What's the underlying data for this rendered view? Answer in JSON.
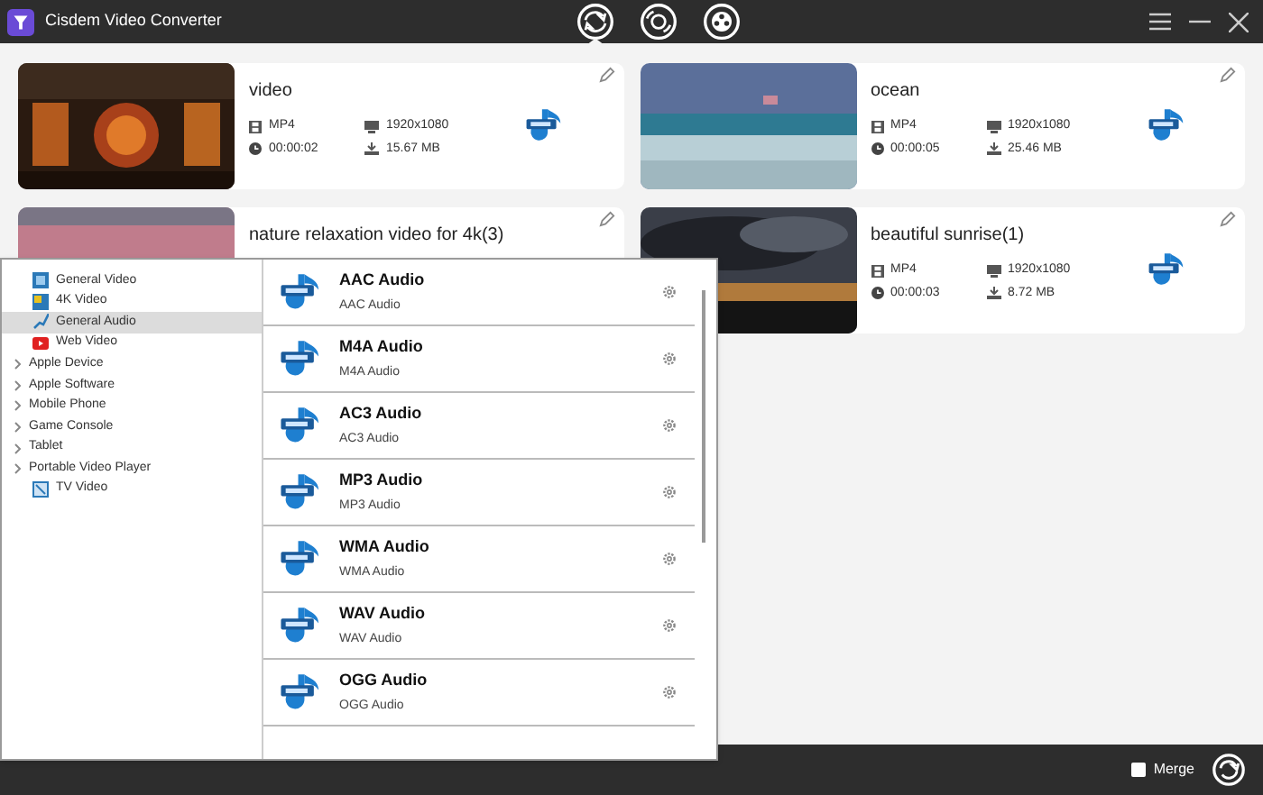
{
  "window": {
    "title": "Cisdem Video Converter"
  },
  "nav_tabs": [
    {
      "kind": "convert",
      "selected": true
    },
    {
      "kind": "rip",
      "selected": false
    },
    {
      "kind": "download",
      "selected": false
    }
  ],
  "tasks": [
    {
      "name": "video",
      "format": "MP4",
      "duration": "00:00:02",
      "resolution": "1920x1080",
      "size": "15.67 MB"
    },
    {
      "name": "ocean",
      "format": "MP4",
      "duration": "00:00:05",
      "resolution": "1920x1080",
      "size": "25.46 MB"
    },
    {
      "name": "nature relaxation video for 4k(3)"
    },
    {
      "name": "beautiful sunrise(1)",
      "format": "MP4",
      "duration": "00:00:03",
      "resolution": "1920x1080",
      "size": "8.72 MB"
    }
  ],
  "format_popup": {
    "categories": [
      {
        "kind": "video",
        "label": "General Video",
        "selected": false
      },
      {
        "kind": "uhd",
        "label": "4K Video",
        "selected": false
      },
      {
        "kind": "audio",
        "label": "General Audio",
        "selected": true
      },
      {
        "kind": "web",
        "label": "Web Video",
        "selected": false
      },
      {
        "kind": "group",
        "label": "Apple Device",
        "selected": false
      },
      {
        "kind": "group",
        "label": "Apple Software",
        "selected": false
      },
      {
        "kind": "group",
        "label": "Mobile Phone",
        "selected": false
      },
      {
        "kind": "group",
        "label": "Game Console",
        "selected": false
      },
      {
        "kind": "group",
        "label": "Tablet",
        "selected": false
      },
      {
        "kind": "group",
        "label": "Portable Video Player",
        "selected": false
      },
      {
        "kind": "tv",
        "label": "TV Video",
        "selected": false
      }
    ],
    "formats": [
      {
        "name": "AAC Audio",
        "description": "AAC Audio"
      },
      {
        "name": "M4A Audio",
        "description": "M4A Audio"
      },
      {
        "name": "AC3 Audio",
        "description": "AC3 Audio"
      },
      {
        "name": "MP3 Audio",
        "description": "MP3 Audio"
      },
      {
        "name": "WMA Audio",
        "description": "WMA Audio"
      },
      {
        "name": "WAV Audio",
        "description": "WAV Audio"
      },
      {
        "name": "OGG Audio",
        "description": "OGG Audio"
      }
    ]
  },
  "merge": {
    "label": "Merge",
    "checked": false
  }
}
